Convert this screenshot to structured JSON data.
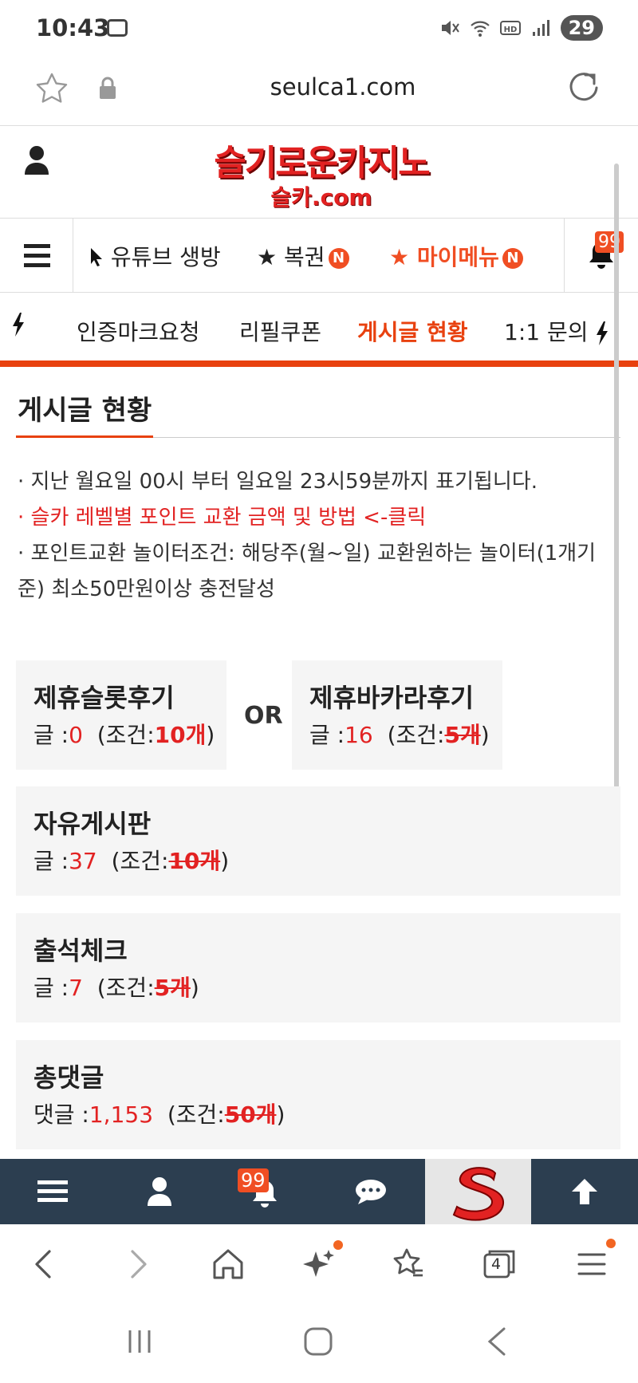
{
  "status_bar": {
    "time": "10:43",
    "battery": "29"
  },
  "browser": {
    "url": "seulca1.com",
    "tab_count": "4"
  },
  "site": {
    "logo_line1": "슬기로운카지노",
    "logo_line2": "슬카.com",
    "notification_count": "99"
  },
  "nav1": {
    "items": [
      {
        "label": "유튜브 생방"
      },
      {
        "label": "★ 복권",
        "badge": "N"
      },
      {
        "label": "★ 마이메뉴",
        "badge": "N"
      }
    ]
  },
  "nav2": {
    "items": [
      {
        "label": "인증마크요청"
      },
      {
        "label": "리필쿠폰"
      },
      {
        "label": "게시글 현황",
        "active": true
      },
      {
        "label": "1:1 문의"
      }
    ]
  },
  "page": {
    "title": "게시글 현황",
    "info1": "· 지난 월요일 00시 부터 일요일 23시59분까지 표기됩니다.",
    "info2": "· 슬카 레벨별 포인트 교환 금액 및 방법 <-클릭",
    "info3a": "· 포인트교환 놀이터조건: 해당주(월~일) 교환원하는 놀이터(1개기",
    "info3b": "준) 최소50만원이상 충전달성",
    "or_label": "OR"
  },
  "cards": {
    "slot": {
      "title": "제휴슬롯후기",
      "count_label": "글 :",
      "count": "0",
      "cond_prefix": "(조건:",
      "cond": "10개",
      "cond_suffix": ")"
    },
    "baccarat": {
      "title": "제휴바카라후기",
      "count_label": "글 :",
      "count": "16",
      "cond_prefix": "(조건:",
      "cond": "5개",
      "cond_suffix": ")"
    },
    "free": {
      "title": "자유게시판",
      "count_label": "글 :",
      "count": "37",
      "cond_prefix": "(조건:",
      "cond": "10개",
      "cond_suffix": ")"
    },
    "attend": {
      "title": "출석체크",
      "count_label": "글 :",
      "count": "7",
      "cond_prefix": "(조건:",
      "cond": "5개",
      "cond_suffix": ")"
    },
    "comments": {
      "title": "총댓글",
      "count_label": "댓글 :",
      "count": "1,153",
      "cond_prefix": "(조건:",
      "cond": "50개",
      "cond_suffix": ")"
    }
  },
  "colors": {
    "accent": "#e8410f",
    "red": "#e22222",
    "dark_bar": "#2c3e50"
  }
}
